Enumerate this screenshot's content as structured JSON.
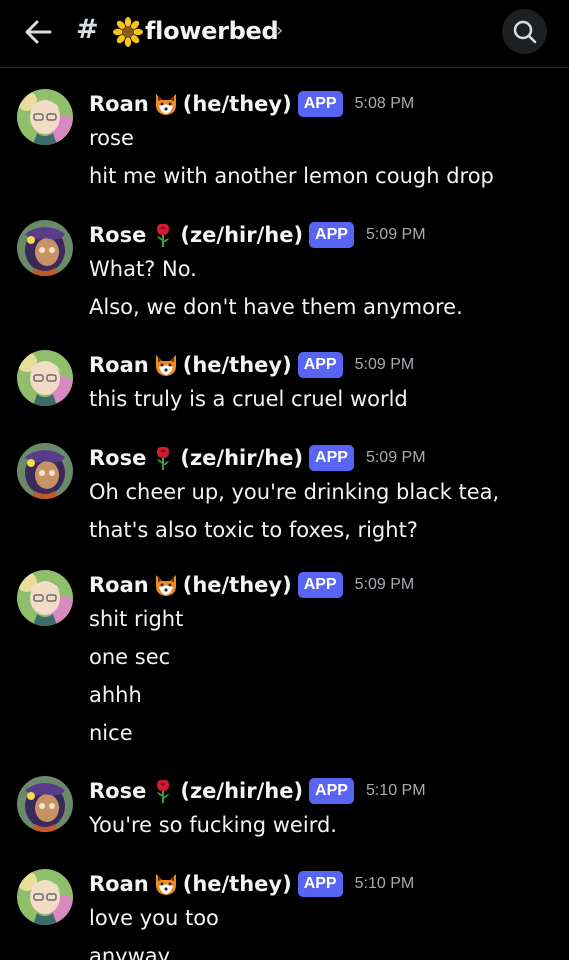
{
  "header": {
    "hash_symbol": "#",
    "channel_name": "flowerbed",
    "channel_icon": "sunflower-icon",
    "chevron": "›"
  },
  "colors": {
    "background": "#000000",
    "app_badge": "#5865f2",
    "timestamp": "#a7abb1",
    "text": "#f2f3f5"
  },
  "messages": [
    {
      "author": "Roan",
      "emoji": "fox-icon",
      "pronouns": "(he/they)",
      "badge": "APP",
      "time": "5:08 PM",
      "lines": [
        "rose",
        "hit me with another lemon cough drop"
      ]
    },
    {
      "author": "Rose",
      "emoji": "rose-icon",
      "pronouns": "(ze/hir/he)",
      "badge": "APP",
      "time": "5:09 PM",
      "lines": [
        "What? No.",
        "Also, we don't have them anymore."
      ]
    },
    {
      "author": "Roan",
      "emoji": "fox-icon",
      "pronouns": "(he/they)",
      "badge": "APP",
      "time": "5:09 PM",
      "lines": [
        "this truly is a cruel cruel world"
      ]
    },
    {
      "author": "Rose",
      "emoji": "rose-icon",
      "pronouns": "(ze/hir/he)",
      "badge": "APP",
      "time": "5:09 PM",
      "lines": [
        "Oh cheer up, you're drinking black tea,",
        "that's also toxic to foxes, right?"
      ]
    },
    {
      "author": "Roan",
      "emoji": "fox-icon",
      "pronouns": "(he/they)",
      "badge": "APP",
      "time": "5:09 PM",
      "lines": [
        "shit right",
        "one sec",
        "ahhh",
        "nice"
      ]
    },
    {
      "author": "Rose",
      "emoji": "rose-icon",
      "pronouns": "(ze/hir/he)",
      "badge": "APP",
      "time": "5:10 PM",
      "lines": [
        "You're so fucking weird."
      ]
    },
    {
      "author": "Roan",
      "emoji": "fox-icon",
      "pronouns": "(he/they)",
      "badge": "APP",
      "time": "5:10 PM",
      "lines": [
        "love you too",
        "anyway"
      ]
    }
  ]
}
